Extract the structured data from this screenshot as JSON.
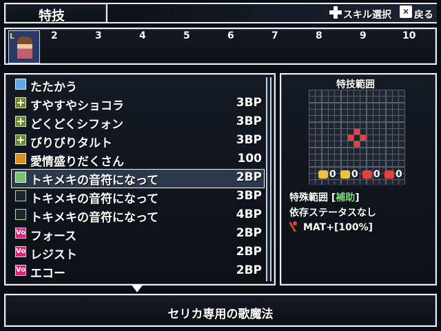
{
  "header": {
    "title": "特技",
    "skill_select_label": "スキル選択",
    "back_label": "戻る"
  },
  "party": {
    "slots": [
      "2",
      "3",
      "4",
      "5",
      "6",
      "7",
      "8",
      "9",
      "10"
    ]
  },
  "skills": [
    {
      "name": "たたかう",
      "cost": "",
      "icon": "sword-icon"
    },
    {
      "name": "すやすやショコラ",
      "cost": "3BP",
      "icon": "plus-icon"
    },
    {
      "name": "どくどくシフォン",
      "cost": "3BP",
      "icon": "plus-icon"
    },
    {
      "name": "びりびりタルト",
      "cost": "3BP",
      "icon": "plus-icon"
    },
    {
      "name": "愛情盛りだくさん",
      "cost": "100",
      "icon": "heart-icon"
    },
    {
      "name": "トキメキの音符になって",
      "cost": "2BP",
      "icon": "note-icon"
    },
    {
      "name": "トキメキの音符になって",
      "cost": "3BP",
      "icon": "note-plus-icon"
    },
    {
      "name": "トキメキの音符になって",
      "cost": "4BP",
      "icon": "note-plus-icon"
    },
    {
      "name": "フォース",
      "cost": "2BP",
      "icon": "vo-icon"
    },
    {
      "name": "レジスト",
      "cost": "2BP",
      "icon": "vo-icon"
    },
    {
      "name": "エコー",
      "cost": "2BP",
      "icon": "vo-icon"
    }
  ],
  "info": {
    "range_title": "特技範囲",
    "counters": [
      "0",
      "0",
      "0",
      "0"
    ],
    "special_range_label": "特殊範囲",
    "special_range_value": "補助",
    "bracket_open": "[",
    "bracket_close": "]",
    "dependency": "依存ステータスなし",
    "mat": "MAT+[100%]"
  },
  "description": "セリカ専用の歌魔法",
  "colors": {
    "accent_green": "#7ee07e",
    "highlight_red": "#e84040"
  }
}
